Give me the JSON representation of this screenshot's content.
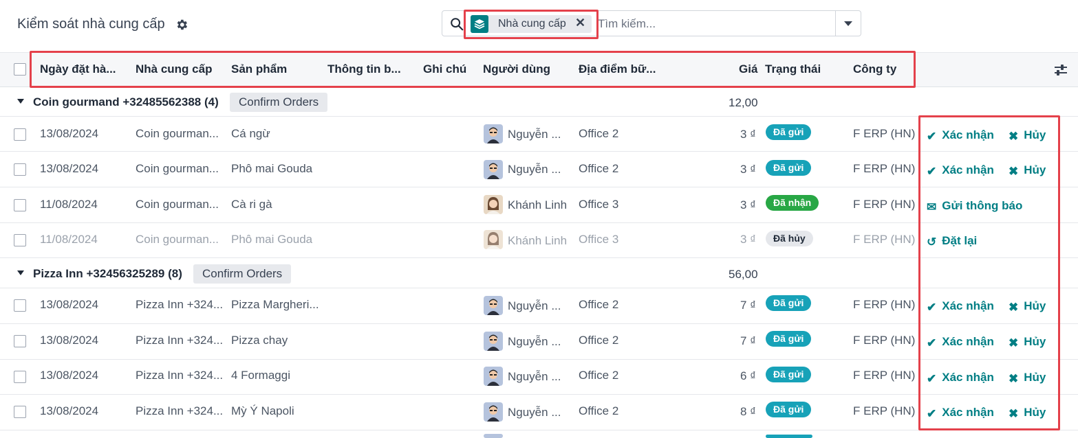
{
  "page_title": "Kiểm soát nhà cung cấp",
  "search": {
    "facet_label": "Nhà cung cấp",
    "placeholder": "Tìm kiếm..."
  },
  "columns": [
    "Ngày đặt hà...",
    "Nhà cung cấp",
    "Sản phẩm",
    "Thông tin b...",
    "Ghi chú",
    "Người dùng",
    "Địa điểm bữ...",
    "Giá",
    "Trạng thái",
    "Công ty"
  ],
  "groups": [
    {
      "label": "Coin gourmand +32485562388 (4)",
      "button": "Confirm Orders",
      "total": "12,00",
      "rows": [
        {
          "date": "13/08/2024",
          "vendor": "Coin gourman...",
          "product": "Cá ngừ",
          "user": "Nguyễn ...",
          "location": "Office 2",
          "price": "3 ₫",
          "status": "Đã gửi",
          "company": "F ERP (HN)",
          "actions": [
            "Xác nhận",
            "Hủy"
          ]
        },
        {
          "date": "13/08/2024",
          "vendor": "Coin gourman...",
          "product": "Phô mai Gouda",
          "user": "Nguyễn ...",
          "location": "Office 2",
          "price": "3 ₫",
          "status": "Đã gửi",
          "company": "F ERP (HN)",
          "actions": [
            "Xác nhận",
            "Hủy"
          ]
        },
        {
          "date": "11/08/2024",
          "vendor": "Coin gourman...",
          "product": "Cà ri gà",
          "user": "Khánh Linh",
          "location": "Office 3",
          "price": "3 ₫",
          "status": "Đã nhận",
          "company": "F ERP (HN)",
          "actions": [
            "Gửi thông báo"
          ]
        },
        {
          "date": "11/08/2024",
          "vendor": "Coin gourman...",
          "product": "Phô mai Gouda",
          "user": "Khánh Linh",
          "location": "Office 3",
          "price": "3 ₫",
          "status": "Đã hủy",
          "company": "F ERP (HN)",
          "actions": [
            "Đặt lại"
          ]
        }
      ]
    },
    {
      "label": "Pizza Inn +32456325289 (8)",
      "button": "Confirm Orders",
      "total": "56,00",
      "rows": [
        {
          "date": "13/08/2024",
          "vendor": "Pizza Inn +324...",
          "product": "Pizza Margheri...",
          "user": "Nguyễn ...",
          "location": "Office 2",
          "price": "7 ₫",
          "status": "Đã gửi",
          "company": "F ERP (HN)",
          "actions": [
            "Xác nhận",
            "Hủy"
          ]
        },
        {
          "date": "13/08/2024",
          "vendor": "Pizza Inn +324...",
          "product": "Pizza chay",
          "user": "Nguyễn ...",
          "location": "Office 2",
          "price": "7 ₫",
          "status": "Đã gửi",
          "company": "F ERP (HN)",
          "actions": [
            "Xác nhận",
            "Hủy"
          ]
        },
        {
          "date": "13/08/2024",
          "vendor": "Pizza Inn +324...",
          "product": "4 Formaggi",
          "user": "Nguyễn ...",
          "location": "Office 2",
          "price": "6 ₫",
          "status": "Đã gửi",
          "company": "F ERP (HN)",
          "actions": [
            "Xác nhận",
            "Hủy"
          ]
        },
        {
          "date": "13/08/2024",
          "vendor": "Pizza Inn +324...",
          "product": "Mỳ Ý Napoli",
          "user": "Nguyễn ...",
          "location": "Office 2",
          "price": "8 ₫",
          "status": "Đã gửi",
          "company": "F ERP (HN)",
          "actions": [
            "Xác nhận",
            "Hủy"
          ]
        }
      ]
    }
  ],
  "colors": {
    "accent": "#017e84",
    "highlight_box": "#e4414b",
    "status_sent": "#17a2b8",
    "status_received": "#28a745",
    "status_cancelled": "#e5e7eb"
  }
}
